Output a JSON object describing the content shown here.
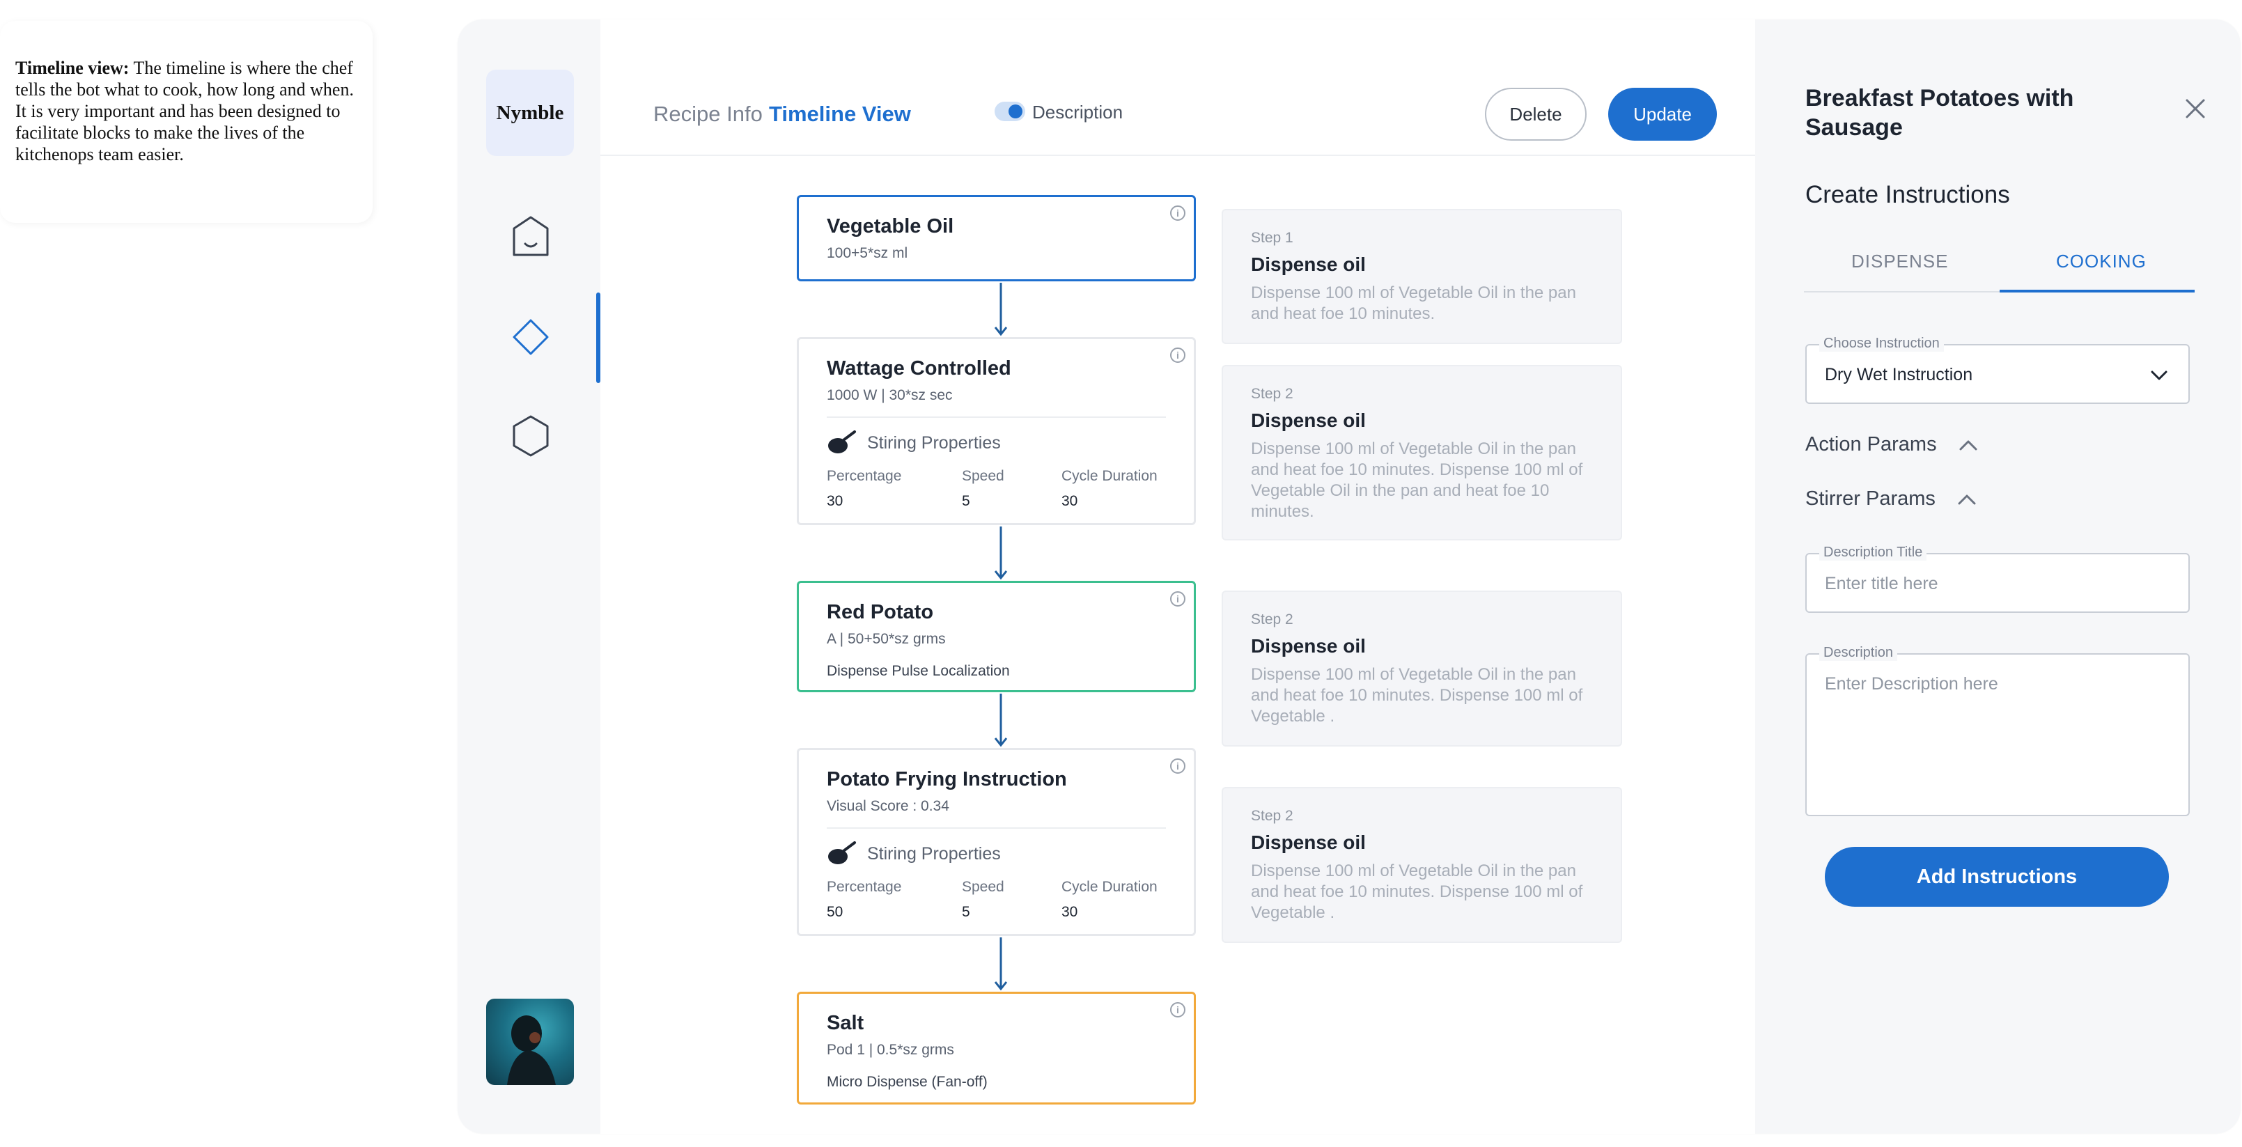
{
  "annotation": {
    "label": "Timeline view:",
    "text": " The timeline is where the chef tells the bot what to cook, how long and when. It is very important and has been designed to facilitate blocks to make the lives of the kitchenops team easier."
  },
  "sidebar": {
    "logo": "Nymble",
    "items": [
      {
        "icon": "home-icon"
      },
      {
        "icon": "diamond-icon",
        "active": true
      },
      {
        "icon": "hexagon-icon"
      }
    ],
    "avatar": "user-avatar"
  },
  "header": {
    "tabs": [
      "Recipe Info",
      "Timeline View"
    ],
    "active_tab": "Timeline View",
    "toggle_label": "Description",
    "toggle_on": true,
    "delete_label": "Delete",
    "update_label": "Update"
  },
  "timeline": {
    "blocks": [
      {
        "title": "Vegetable Oil",
        "subtitle": "100+5*sz ml",
        "color": "#1e6fcf"
      },
      {
        "title": "Wattage Controlled",
        "subtitle": "1000 W | 30*sz sec",
        "stir_label": "Stiring Properties",
        "params": [
          {
            "label": "Percentage",
            "value": "30"
          },
          {
            "label": "Speed",
            "value": "5"
          },
          {
            "label": "Cycle Duration",
            "value": "30"
          }
        ]
      },
      {
        "title": "Red Potato",
        "subtitle": "A | 50+50*sz grms",
        "extra": "Dispense Pulse Localization",
        "color": "#3bbf8f"
      },
      {
        "title": "Potato Frying Instruction",
        "subtitle": "Visual Score : 0.34",
        "stir_label": "Stiring Properties",
        "params": [
          {
            "label": "Percentage",
            "value": "50"
          },
          {
            "label": "Speed",
            "value": "5"
          },
          {
            "label": "Cycle Duration",
            "value": "30"
          }
        ]
      },
      {
        "title": "Salt",
        "subtitle": "Pod 1 | 0.5*sz grms",
        "extra": "Micro Dispense (Fan-off)",
        "color": "#f2a93b"
      }
    ],
    "steps": [
      {
        "num": "Step 1",
        "title": "Dispense oil",
        "desc": "Dispense 100 ml of Vegetable Oil in the pan and heat foe 10 minutes."
      },
      {
        "num": "Step 2",
        "title": "Dispense oil",
        "desc": "Dispense 100 ml of Vegetable Oil in the pan and heat foe 10 minutes. Dispense 100 ml of Vegetable Oil in the pan and heat foe 10 minutes."
      },
      {
        "num": "Step 2",
        "title": "Dispense oil",
        "desc": "Dispense 100 ml of Vegetable Oil in the pan and heat foe 10 minutes. Dispense 100 ml of Vegetable ."
      },
      {
        "num": "Step 2",
        "title": "Dispense oil",
        "desc": "Dispense 100 ml of Vegetable Oil in the pan and heat foe 10 minutes. Dispense 100 ml of Vegetable ."
      }
    ]
  },
  "panel": {
    "title": "Breakfast Potatoes with Sausage",
    "subtitle": "Create Instructions",
    "tabs": [
      "DISPENSE",
      "COOKING"
    ],
    "active_tab": "COOKING",
    "choose_instruction": {
      "legend": "Choose Instruction",
      "value": "Dry Wet Instruction"
    },
    "sections": [
      "Action Params",
      "Stirrer Params"
    ],
    "description_title": {
      "legend": "Description Title",
      "placeholder": "Enter title here"
    },
    "description": {
      "legend": "Description",
      "placeholder": "Enter Description here"
    },
    "add_button": "Add Instructions"
  },
  "colors": {
    "accent": "#1e6fcf",
    "green_block": "#3bbf8f",
    "orange_block": "#f2a93b"
  }
}
